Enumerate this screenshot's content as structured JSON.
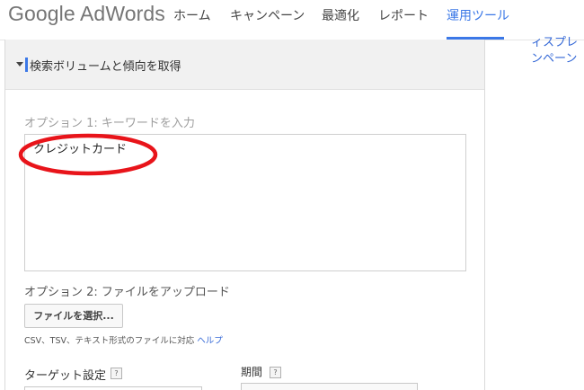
{
  "header": {
    "logo": "Google AdWords",
    "nav": [
      {
        "label": "ホーム"
      },
      {
        "label": "キャンペーン"
      },
      {
        "label": "最適化"
      },
      {
        "label": "レポート"
      },
      {
        "label": "運用ツール",
        "active": true
      }
    ],
    "accent_color": "#3b78e7"
  },
  "side_links": [
    "ィスプレ",
    "ンペーン"
  ],
  "panel": {
    "title": "検索ボリュームと傾向を取得",
    "option1_label": "オプション 1: キーワードを入力",
    "keyword_value": "クレジットカード",
    "option2_label": "オプション 2: ファイルをアップロード",
    "file_button_label": "ファイルを選択...",
    "file_note": "CSV、TSV、テキスト形式のファイルに対応",
    "help_link": "ヘルプ",
    "target_label": "ターゲット設定",
    "period_label": "期間",
    "help_icon": "?"
  },
  "annotation": {
    "shape": "ellipse",
    "color": "#e8141a"
  }
}
